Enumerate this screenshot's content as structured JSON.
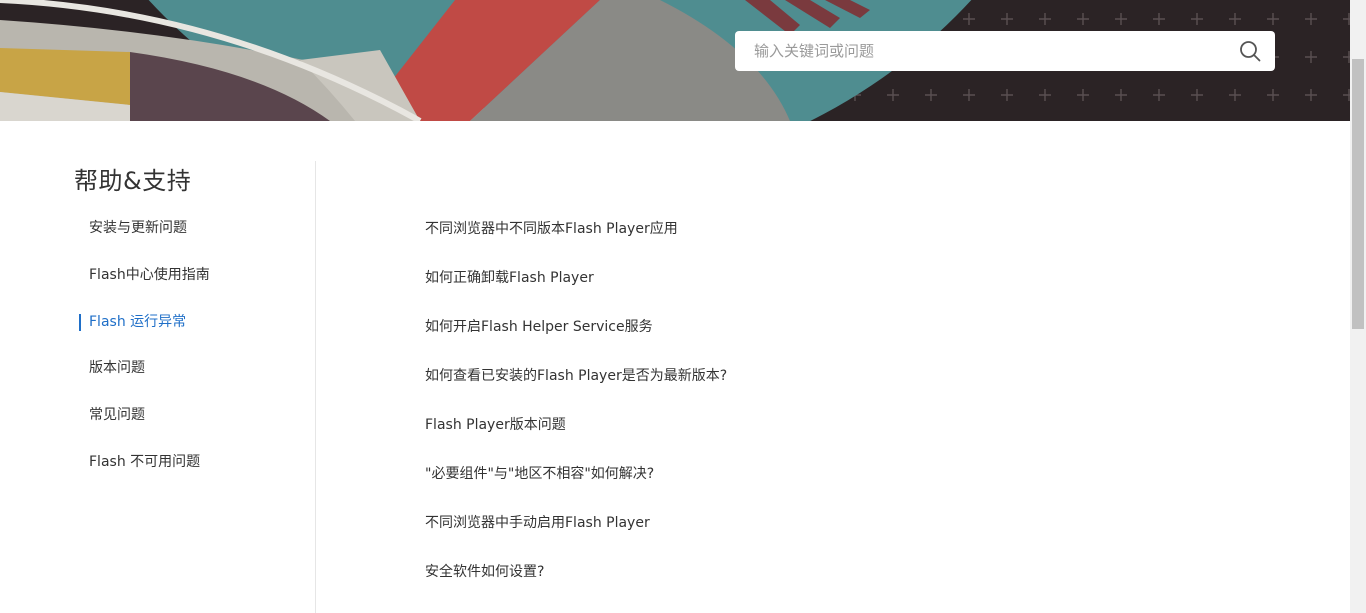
{
  "search": {
    "placeholder": "输入关键词或问题",
    "value": ""
  },
  "sidebar": {
    "title": "帮助&支持",
    "items": [
      {
        "label": "安装与更新问题",
        "active": false
      },
      {
        "label": "Flash中心使用指南",
        "active": false
      },
      {
        "label": "Flash 运行异常",
        "active": true
      },
      {
        "label": "版本问题",
        "active": false
      },
      {
        "label": "常见问题",
        "active": false
      },
      {
        "label": "Flash 不可用问题",
        "active": false
      }
    ]
  },
  "faq": {
    "items": [
      "不同浏览器中不同版本Flash Player应用",
      "如何正确卸载Flash Player",
      "如何开启Flash Helper Service服务",
      "如何查看已安装的Flash Player是否为最新版本?",
      "Flash Player版本问题",
      "\"必要组件\"与\"地区不相容\"如何解决?",
      "不同浏览器中手动启用Flash Player",
      "安全软件如何设置?"
    ]
  },
  "colors": {
    "accent": "#1f6fc8",
    "text": "#333333",
    "banner_dark": "#2b2325",
    "banner_teal": "#4f8d90",
    "banner_red": "#c04a45",
    "banner_gold": "#c8a446",
    "banner_gray": "#8a8a86"
  },
  "icons": {
    "search": "search-icon"
  }
}
